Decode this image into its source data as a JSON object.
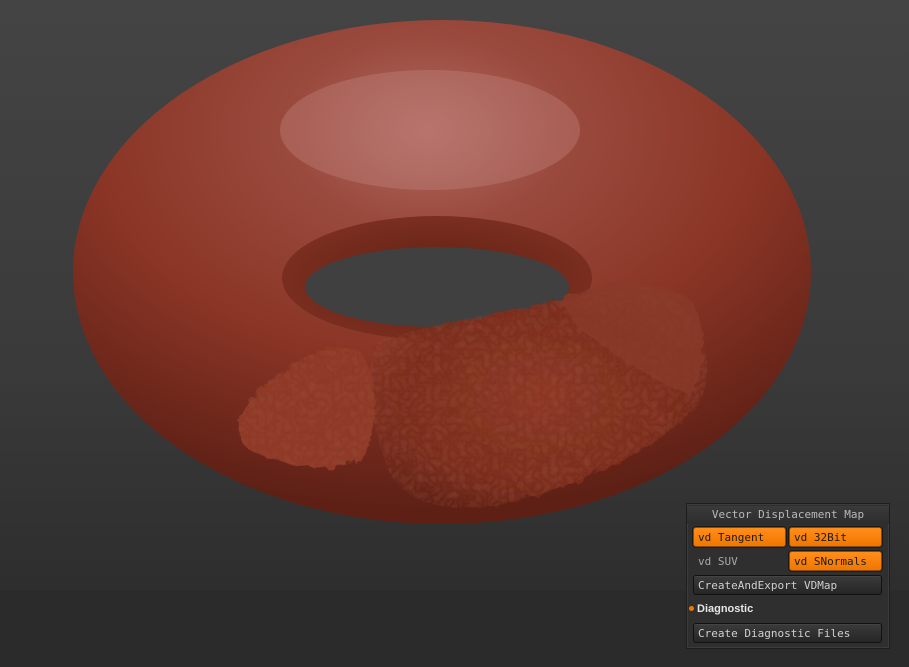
{
  "viewport": {
    "object_name": "",
    "accent_color": "#f07700",
    "model_color": "#8c3a2b"
  },
  "vdm_panel": {
    "title": "Vector Displacement Map",
    "buttons": {
      "tangent": {
        "label": "vd Tangent",
        "state": "on"
      },
      "bit32": {
        "label": "vd 32Bit",
        "state": "on"
      },
      "suv": {
        "label": "vd SUV",
        "state": "off"
      },
      "snormals": {
        "label": "vd SNormals",
        "state": "on"
      },
      "create_export": {
        "label": "CreateAndExport VDMap"
      }
    },
    "diagnostic": {
      "label": "Diagnostic",
      "create_files": {
        "label": "Create Diagnostic Files"
      }
    }
  }
}
